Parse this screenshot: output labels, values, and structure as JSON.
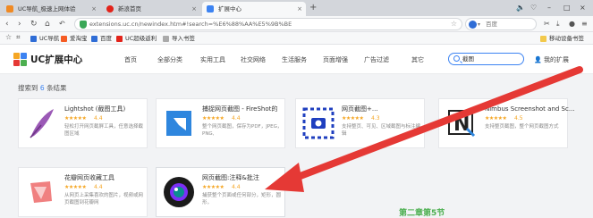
{
  "tabs": [
    {
      "title": "UC导航_极速上网体验",
      "color": "#f08a24"
    },
    {
      "title": "新浪首页",
      "color": "#e2231a"
    },
    {
      "title": "扩展中心",
      "color": "#3c83f2"
    }
  ],
  "address": {
    "url": "extensions.uc.cn/newindex.htm#!search=%E6%88%AA%E5%9B%BE",
    "search_engine": "百度"
  },
  "bookmarks": [
    {
      "label": "UC导航",
      "color": "#2f6dd6"
    },
    {
      "label": "爱淘宝",
      "color": "#f55b23"
    },
    {
      "label": "百度",
      "color": "#2f6dd6"
    },
    {
      "label": "UC超级返利",
      "color": "#e2231a"
    },
    {
      "label": "导入书签",
      "color": "#aaaaaa"
    }
  ],
  "bookmarks_right": "移动设备书签",
  "site": {
    "brand": "UC扩展中心",
    "menu": [
      "首页",
      "全部分类",
      "实用工具",
      "社交网络",
      "生活服务",
      "页面增强",
      "广告过滤",
      "其它"
    ],
    "search_value": "截图",
    "user_label": "我的扩展"
  },
  "results": {
    "prefix": "搜索到",
    "count": "6",
    "suffix": "条结果"
  },
  "cards": [
    {
      "name": "Lightshot (截图工具)",
      "stars": "★★★★★",
      "score": "4.4",
      "desc": "轻松打开网页截屏工具，任意选择截图区域",
      "thumb": "lightshot"
    },
    {
      "name": "捕捉网页截图 - FireShot的",
      "stars": "★★★★★",
      "score": "4.4",
      "desc": "整个网页截图，保存为PDF，JPEG，PNG,",
      "thumb": "fireshot"
    },
    {
      "name": "网页截图+...",
      "stars": "★★★★★",
      "score": "4.3",
      "desc": "支持整页、可见、区域截图与标注编辑",
      "thumb": "webcapture"
    },
    {
      "name": "Nimbus Screenshot and Sc...",
      "stars": "★★★★★",
      "score": "4.5",
      "desc": "支持整页截图，整个网页截图方式",
      "thumb": "nimbus"
    },
    {
      "name": "花瓣网页收藏工具",
      "stars": "★★★★★",
      "score": "4.4",
      "desc": "从网页上采集喜欢的图片，视频或网页截图到花瓣网",
      "thumb": "huaban"
    },
    {
      "name": "网页截图:注释&批注",
      "stars": "★★★★★",
      "score": "4.4",
      "desc": "捕获整个页面或任何部分，矩形，圆形，",
      "thumb": "awesome"
    }
  ],
  "overlay_text": "第二章第5节",
  "colors": {
    "accent": "#3c83f2",
    "arrow": "#e53935",
    "star": "#f5a623"
  }
}
